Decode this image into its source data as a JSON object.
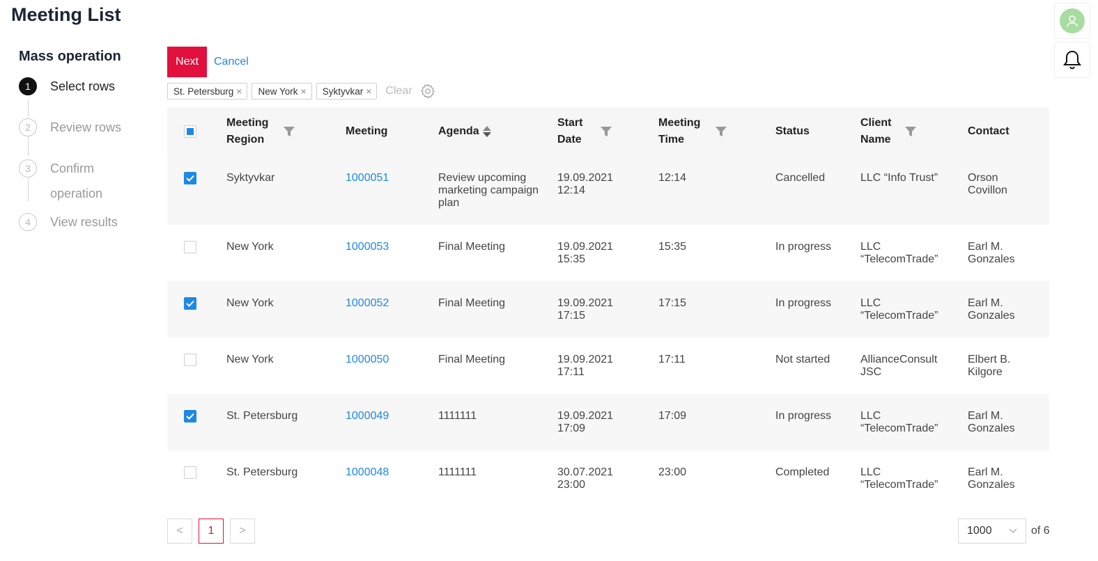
{
  "page": {
    "title": "Meeting List"
  },
  "wizard": {
    "title": "Mass operation",
    "steps": [
      {
        "number": "1",
        "label": "Select rows"
      },
      {
        "number": "2",
        "label": "Review rows"
      },
      {
        "number": "3",
        "label": "Confirm operation"
      },
      {
        "number": "4",
        "label": "View results"
      }
    ]
  },
  "toolbar": {
    "next_label": "Next",
    "cancel_label": "Cancel"
  },
  "filters": {
    "chips": [
      "St. Petersburg",
      "New York",
      "Syktyvkar"
    ],
    "clear_label": "Clear"
  },
  "table": {
    "columns": [
      {
        "label": "Meeting Region"
      },
      {
        "label": "Meeting"
      },
      {
        "label": "Agenda"
      },
      {
        "label": "Start Date"
      },
      {
        "label": "Meeting Time"
      },
      {
        "label": "Status"
      },
      {
        "label": "Client Name"
      },
      {
        "label": "Contact"
      }
    ],
    "rows": [
      {
        "checked": true,
        "region": "Syktyvkar",
        "meeting": "1000051",
        "agenda": "Review upcoming marketing campaign plan",
        "start_date": "19.09.2021",
        "start_time": "12:14",
        "meeting_time": "12:14",
        "status": "Cancelled",
        "client": "LLC “Info Trust”",
        "contact": "Orson Covillon"
      },
      {
        "checked": false,
        "region": "New York",
        "meeting": "1000053",
        "agenda": "Final Meeting",
        "start_date": "19.09.2021",
        "start_time": "15:35",
        "meeting_time": "15:35",
        "status": "In progress",
        "client": "LLC “TelecomTrade”",
        "contact": "Earl M. Gonzales"
      },
      {
        "checked": true,
        "region": "New York",
        "meeting": "1000052",
        "agenda": "Final Meeting",
        "start_date": "19.09.2021",
        "start_time": "17:15",
        "meeting_time": "17:15",
        "status": "In progress",
        "client": "LLC “TelecomTrade”",
        "contact": "Earl M. Gonzales"
      },
      {
        "checked": false,
        "region": "New York",
        "meeting": "1000050",
        "agenda": "Final Meeting",
        "start_date": "19.09.2021",
        "start_time": "17:11",
        "meeting_time": "17:11",
        "status": "Not started",
        "client": "AllianceConsult JSC",
        "contact": "Elbert B. Kilgore"
      },
      {
        "checked": true,
        "region": "St. Petersburg",
        "meeting": "1000049",
        "agenda": "1111111",
        "start_date": "19.09.2021",
        "start_time": "17:09",
        "meeting_time": "17:09",
        "status": "In progress",
        "client": "LLC “TelecomTrade”",
        "contact": "Earl M. Gonzales"
      },
      {
        "checked": false,
        "region": "St. Petersburg",
        "meeting": "1000048",
        "agenda": "1111111",
        "start_date": "30.07.2021",
        "start_time": "23:00",
        "meeting_time": "23:00",
        "status": "Completed",
        "client": "LLC “TelecomTrade”",
        "contact": "Earl M. Gonzales"
      }
    ]
  },
  "pagination": {
    "prev": "<",
    "current_page": "1",
    "next": ">",
    "page_size": "1000",
    "of_label": "of 6"
  },
  "colors": {
    "accent": "#e2103c",
    "link": "#1e88e5",
    "avatar": "#a9dca0"
  }
}
